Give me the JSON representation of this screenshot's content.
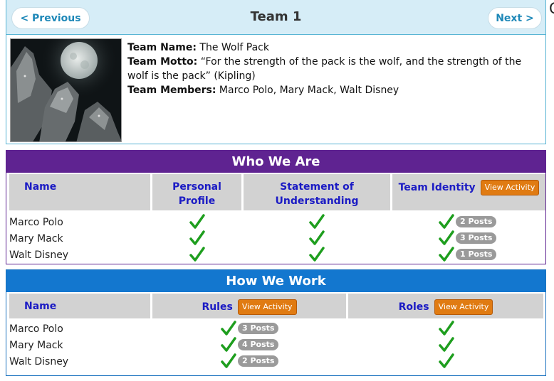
{
  "page": {
    "edge_letter": "C"
  },
  "team": {
    "title": "Team 1",
    "prev_label": "< Previous",
    "next_label": "Next >",
    "name_label": "Team Name:",
    "name": "The Wolf Pack",
    "motto_label": "Team Motto:",
    "motto": "“For the strength of the pack is the wolf, and the strength of the wolf is the pack” (Kipling)",
    "members_label": "Team Members:",
    "members": "Marco Polo, Mary Mack, Walt Disney"
  },
  "who": {
    "title": "Who We Are",
    "color": "#5f2391",
    "headers": {
      "name": "Name",
      "profile": "Personal Profile",
      "statement": "Statement of Understanding",
      "identity": "Team Identity"
    },
    "view_activity": "View Activity",
    "rows": [
      {
        "name": "Marco Polo",
        "posts": "2 Posts"
      },
      {
        "name": "Mary Mack",
        "posts": "3 Posts"
      },
      {
        "name": "Walt Disney",
        "posts": "1 Posts"
      }
    ]
  },
  "how": {
    "title": "How We Work",
    "color": "#1377cf",
    "headers": {
      "name": "Name",
      "rules": "Rules",
      "roles": "Roles"
    },
    "view_activity": "View Activity",
    "rows": [
      {
        "name": "Marco Polo",
        "posts": "3 Posts"
      },
      {
        "name": "Mary Mack",
        "posts": "4 Posts"
      },
      {
        "name": "Walt Disney",
        "posts": "2 Posts"
      }
    ]
  },
  "icons": {
    "check": "checkmark-icon",
    "accent_green": "#1e9e1e"
  }
}
